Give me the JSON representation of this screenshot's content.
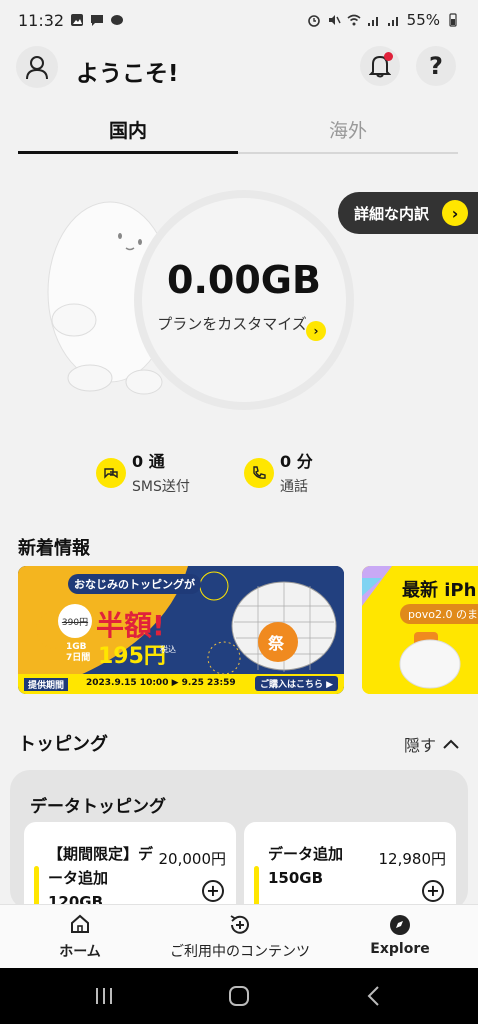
{
  "status_bar": {
    "time": "11:32",
    "battery": "55%"
  },
  "header": {
    "welcome": "ようこそ!",
    "help_label": "?"
  },
  "tabs": [
    {
      "label": "国内",
      "active": true
    },
    {
      "label": "海外",
      "active": false
    }
  ],
  "hero": {
    "data_remaining": "0.00GB",
    "customize_label": "プランをカスタマイズ",
    "detail_label": "詳細な内訳"
  },
  "usage": {
    "sms": {
      "value": "0 通",
      "label": "SMS送付"
    },
    "call": {
      "value": "0 分",
      "label": "通話"
    }
  },
  "news": {
    "title": "新着情報",
    "banner1": {
      "headline": "おなじみのトッピングが",
      "half_price": "半額!",
      "old_price": "390円",
      "plan": "1GB 7日間",
      "price": "195円",
      "tax": "税込",
      "period_label": "提供期間",
      "period": "2023.9.15 10:00 ▶ 9.25 23:59",
      "cta": "ご購入はこちら ▶",
      "badge": "祭"
    },
    "banner2": {
      "headline": "最新 iPh",
      "sub": "povo2.0 のま"
    }
  },
  "topping": {
    "title": "トッピング",
    "hide_label": "隠す",
    "panel_title": "データトッピング",
    "cards": [
      {
        "name": "【期間限定】データ追加120GB",
        "price": "20,000円"
      },
      {
        "name": "データ追加150GB",
        "price": "12,980円"
      }
    ]
  },
  "bottom_nav": [
    {
      "label": "ホーム",
      "icon": "home-icon"
    },
    {
      "label": "ご利用中のコンテンツ",
      "icon": "content-icon"
    },
    {
      "label": "Explore",
      "icon": "compass-icon"
    }
  ],
  "colors": {
    "accent": "#ffe600",
    "dark": "#333333",
    "notification": "#e0223b"
  }
}
